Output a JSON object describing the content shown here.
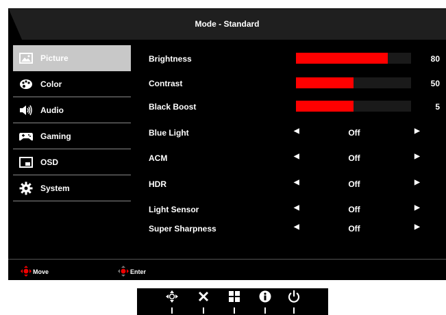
{
  "header": {
    "title": "Mode - Standard"
  },
  "sidebar": {
    "items": [
      {
        "label": "Picture",
        "icon": "picture-icon",
        "active": true
      },
      {
        "label": "Color",
        "icon": "palette-icon",
        "active": false
      },
      {
        "label": "Audio",
        "icon": "speaker-icon",
        "active": false
      },
      {
        "label": "Gaming",
        "icon": "gamepad-icon",
        "active": false
      },
      {
        "label": "OSD",
        "icon": "osd-icon",
        "active": false
      },
      {
        "label": "System",
        "icon": "gear-icon",
        "active": false
      }
    ]
  },
  "settings": {
    "brightness": {
      "label": "Brightness",
      "value": "80",
      "level": 80
    },
    "contrast": {
      "label": "Contrast",
      "value": "50",
      "level": 50
    },
    "black_boost": {
      "label": "Black Boost",
      "value": "5",
      "level": 50
    },
    "blue_light": {
      "label": "Blue Light",
      "value": "Off"
    },
    "acm": {
      "label": "ACM",
      "value": "Off"
    },
    "hdr": {
      "label": "HDR",
      "value": "Off"
    },
    "light_sensor": {
      "label": "Light Sensor",
      "value": "Off"
    },
    "super_sharpness": {
      "label": "Super Sharpness",
      "value": "Off"
    }
  },
  "footer": {
    "move_label": "Move",
    "enter_label": "Enter"
  },
  "keys": [
    "navigation-joystick-icon",
    "close-icon",
    "menu-grid-icon",
    "info-icon",
    "power-icon"
  ],
  "colors": {
    "accent": "#ff0000",
    "active_item": "#c8c8c8",
    "background": "#000000"
  }
}
